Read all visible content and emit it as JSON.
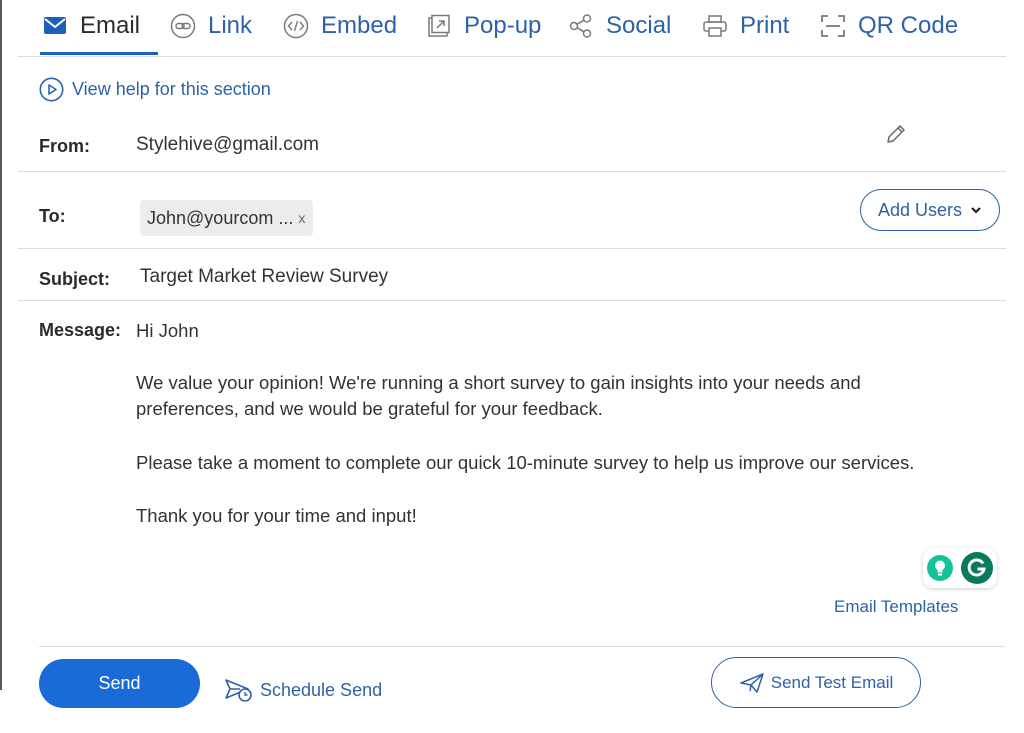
{
  "tabs": [
    {
      "label": "Email",
      "icon": "envelope-icon",
      "active": true
    },
    {
      "label": "Link",
      "icon": "link-icon"
    },
    {
      "label": "Embed",
      "icon": "embed-code-icon"
    },
    {
      "label": "Pop-up",
      "icon": "popup-icon"
    },
    {
      "label": "Social",
      "icon": "share-icon"
    },
    {
      "label": "Print",
      "icon": "printer-icon"
    },
    {
      "label": "QR Code",
      "icon": "qr-scan-icon"
    }
  ],
  "help": {
    "label": "View help for this section",
    "icon": "play-circle-icon"
  },
  "from": {
    "label": "From:",
    "value": "Stylehive@gmail.com"
  },
  "to": {
    "label": "To:",
    "chip": "John@yourcom ...",
    "chip_remove": "x",
    "add_users_label": "Add Users"
  },
  "subject": {
    "label": "Subject:",
    "value": "Target Market Review Survey"
  },
  "message": {
    "label": "Message:",
    "greeting": "Hi John",
    "paragraph1_line1": "We value your opinion! We're running a short survey to gain insights into your needs and",
    "paragraph1_line2": "preferences, and we would be grateful for your feedback.",
    "paragraph2": "Please take a moment to complete our quick 10-minute survey to help us improve our services.",
    "paragraph3": "Thank you for your time and input!"
  },
  "email_templates_label": "Email Templates",
  "footer": {
    "send_label": "Send",
    "schedule_label": "Schedule Send",
    "test_label": "Send Test Email"
  },
  "colors": {
    "accent": "#2e62a8",
    "primary_button": "#1a6ad8",
    "grammarly_green": "#15c39a",
    "grammarly_dark": "#0a7a5c"
  }
}
